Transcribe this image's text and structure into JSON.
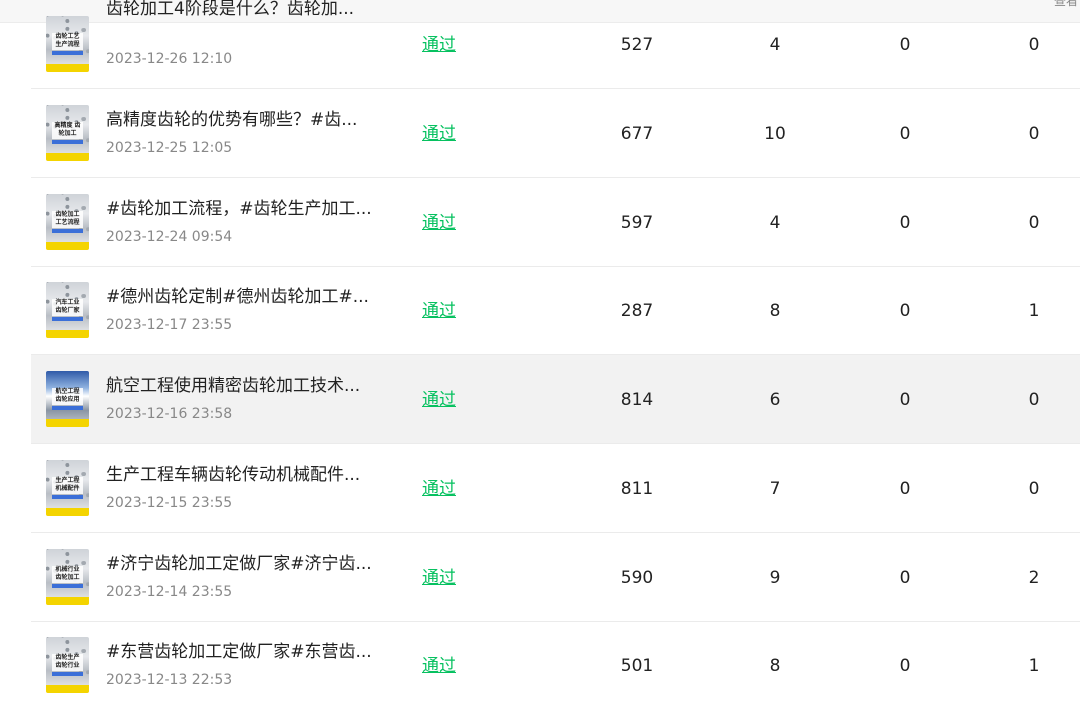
{
  "header": {
    "corner_text": "查看"
  },
  "rows": [
    {
      "thumb_text": "齿轮工艺\n生产流程",
      "title": "齿轮加工4阶段是什么？齿轮加...",
      "date": "2023-12-26 12:10",
      "status": "通过",
      "views": "527",
      "likes": "4",
      "comments": "0",
      "shares": "0"
    },
    {
      "thumb_text": "高精度\n齿轮加工",
      "title": "高精度齿轮的优势有哪些？#齿...",
      "date": "2023-12-25 12:05",
      "status": "通过",
      "views": "677",
      "likes": "10",
      "comments": "0",
      "shares": "0"
    },
    {
      "thumb_text": "齿轮加工\n工艺流程",
      "title": "#齿轮加工流程，#齿轮生产加工...",
      "date": "2023-12-24 09:54",
      "status": "通过",
      "views": "597",
      "likes": "4",
      "comments": "0",
      "shares": "0"
    },
    {
      "thumb_text": "汽车工业\n齿轮厂家",
      "title": "#德州齿轮定制#德州齿轮加工#...",
      "date": "2023-12-17 23:55",
      "status": "通过",
      "views": "287",
      "likes": "8",
      "comments": "0",
      "shares": "1"
    },
    {
      "thumb_text": "航空工程\n齿轮应用",
      "title": "航空工程使用精密齿轮加工技术...",
      "date": "2023-12-16 23:58",
      "status": "通过",
      "views": "814",
      "likes": "6",
      "comments": "0",
      "shares": "0"
    },
    {
      "thumb_text": "生产工程\n机械配件",
      "title": "生产工程车辆齿轮传动机械配件...",
      "date": "2023-12-15 23:55",
      "status": "通过",
      "views": "811",
      "likes": "7",
      "comments": "0",
      "shares": "0"
    },
    {
      "thumb_text": "机械行业\n齿轮加工",
      "title": "#济宁齿轮加工定做厂家#济宁齿...",
      "date": "2023-12-14 23:55",
      "status": "通过",
      "views": "590",
      "likes": "9",
      "comments": "0",
      "shares": "2"
    },
    {
      "thumb_text": "齿轮生产\n齿轮行业",
      "title": "#东营齿轮加工定做厂家#东营齿...",
      "date": "2023-12-13 22:53",
      "status": "通过",
      "views": "501",
      "likes": "8",
      "comments": "0",
      "shares": "1"
    }
  ]
}
